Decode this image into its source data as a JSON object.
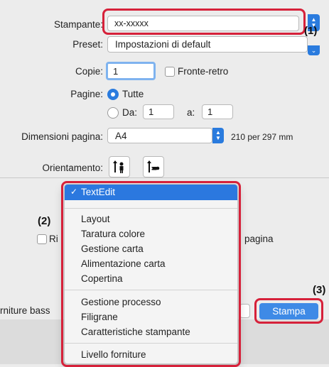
{
  "printer": {
    "label": "Stampante:",
    "value": "xx-xxxxx"
  },
  "preset": {
    "label": "Preset:",
    "value": "Impostazioni di default"
  },
  "copies": {
    "label": "Copie:",
    "value": "1",
    "duplex_label": "Fronte-retro"
  },
  "pages": {
    "label": "Pagine:",
    "all_label": "Tutte",
    "from_label": "Da:",
    "from_value": "1",
    "to_label": "a:",
    "to_value": "1",
    "selected": "Tutte"
  },
  "paper_size": {
    "label": "Dimensioni pagina:",
    "value": "A4",
    "dimensions": "210 per 297 mm"
  },
  "orientation": {
    "label": "Orientamento:"
  },
  "behind_dialog": {
    "checkbox_text_fragment": "Ri",
    "right_text_fragment": "pagina",
    "bottom_left_fragment": "rniture bass"
  },
  "dropdown_menu": {
    "selected_item": "TextEdit",
    "group1": [
      "Layout",
      "Taratura colore",
      "Gestione carta",
      "Alimentazione carta",
      "Copertina"
    ],
    "group2": [
      "Gestione processo",
      "Filigrane",
      "Caratteristiche stampante"
    ],
    "group3": [
      "Livello forniture"
    ]
  },
  "buttons": {
    "print_label": "Stampa"
  },
  "callouts": {
    "c1": "(1)",
    "c2": "(2)",
    "c3": "(3)"
  },
  "colors": {
    "accent": "#2a7bde",
    "highlight": "#d6213a"
  }
}
